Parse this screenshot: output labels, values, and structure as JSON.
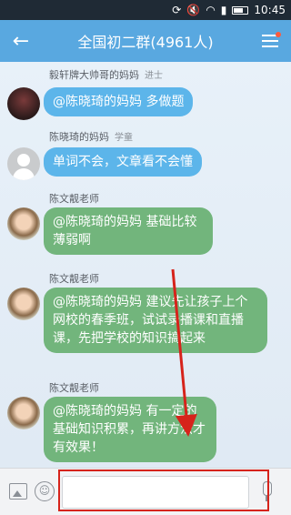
{
  "status_bar": {
    "time": "10:45",
    "icons": [
      "sync-icon",
      "mute-icon",
      "wifi-icon",
      "signal-icon",
      "battery-icon"
    ]
  },
  "header": {
    "title": "全国初二群(4961人)",
    "back_icon": "back-arrow-icon",
    "menu_icon": "menu-icon"
  },
  "messages": [
    {
      "sender": "毅轩牌大帅哥的妈妈",
      "rank": "进士",
      "text": "@陈晓琦的妈妈 多做题",
      "bubble_color": "blue",
      "avatar": "dark"
    },
    {
      "sender": "陈晓琦的妈妈",
      "rank": "学童",
      "text": "单词不会，文章看不会懂",
      "bubble_color": "blue",
      "avatar": "default"
    },
    {
      "sender": "陈文靓老师",
      "rank": "",
      "text": "@陈晓琦的妈妈 基础比较薄弱啊",
      "bubble_color": "green",
      "avatar": "teacher"
    },
    {
      "sender": "陈文靓老师",
      "rank": "",
      "text": "@陈晓琦的妈妈 建议先让孩子上个网校的春季班，试试录播课和直播课，先把学校的知识搞起来",
      "bubble_color": "green",
      "avatar": "teacher"
    },
    {
      "sender": "陈文靓老师",
      "rank": "",
      "text": "@陈晓琦的妈妈 有一定的基础知识积累，再讲方法才有效果！",
      "bubble_color": "green",
      "avatar": "teacher"
    }
  ],
  "input_bar": {
    "value": "",
    "image_icon": "image-icon",
    "emoji_icon": "emoji-icon",
    "mic_icon": "microphone-icon"
  },
  "colors": {
    "header": "#59a8e0",
    "bubble_blue": "#5cb5ea",
    "bubble_green": "#72b57c",
    "annotation": "#d6231b"
  }
}
